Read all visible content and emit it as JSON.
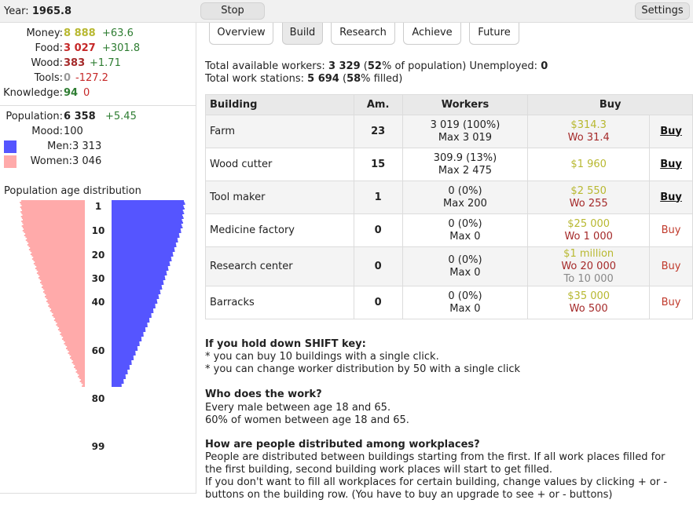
{
  "topbar": {
    "year_label": "Year:",
    "year_value": "1965.8",
    "stop_label": "Stop",
    "settings_label": "Settings"
  },
  "resources": {
    "money": {
      "label": "Money:",
      "value": "8 888",
      "delta": "+63.6"
    },
    "food": {
      "label": "Food:",
      "value": "3 027",
      "delta": "+301.8"
    },
    "wood": {
      "label": "Wood:",
      "value": "383",
      "delta": "+1.71"
    },
    "tools": {
      "label": "Tools:",
      "value": "0",
      "delta": "-127.2"
    },
    "knowledge": {
      "label": "Knowledge:",
      "value": "94",
      "delta": "0"
    }
  },
  "population": {
    "label": "Population:",
    "value": "6 358",
    "delta": "+5.45",
    "mood_label": "Mood:",
    "mood_value": "100",
    "men_label": "Men:",
    "men_value": "3 313",
    "women_label": "Women:",
    "women_value": "3 046",
    "men_color": "#5555ff",
    "women_color": "#ffaaaa"
  },
  "age_distribution": {
    "title": "Population age distribution",
    "age_labels": [
      "1",
      "10",
      "20",
      "30",
      "40",
      "60",
      "80",
      "99"
    ]
  },
  "tabs": [
    {
      "label": "Overview"
    },
    {
      "label": "Build"
    },
    {
      "label": "Research"
    },
    {
      "label": "Achieve"
    },
    {
      "label": "Future"
    }
  ],
  "workers_summary": {
    "available_prefix": "Total available workers:",
    "available_value": "3 329",
    "available_pct": "52",
    "available_suffix": "% of population) Unemployed:",
    "unemployed_value": "0",
    "stations_prefix": "Total work stations:",
    "stations_value": "5 694",
    "stations_pct": "58",
    "stations_suffix": "% filled)"
  },
  "buildings_table": {
    "headers": {
      "building": "Building",
      "amount": "Am.",
      "workers": "Workers",
      "buy": "Buy"
    },
    "rows": [
      {
        "name": "Farm",
        "amount": "23",
        "workers": "3 019 (100%)",
        "max": "Max 3 019",
        "cost_money": "$314.3",
        "cost_wood": "Wo 31.4",
        "cost_tools": "",
        "buy": "Buy",
        "can_buy": true
      },
      {
        "name": "Wood cutter",
        "amount": "15",
        "workers": "309.9 (13%)",
        "max": "Max 2 475",
        "cost_money": "$1 960",
        "cost_wood": "",
        "cost_tools": "",
        "buy": "Buy",
        "can_buy": true
      },
      {
        "name": "Tool maker",
        "amount": "1",
        "workers": "0 (0%)",
        "max": "Max 200",
        "cost_money": "$2 550",
        "cost_wood": "Wo 255",
        "cost_tools": "",
        "buy": "Buy",
        "can_buy": true
      },
      {
        "name": "Medicine factory",
        "amount": "0",
        "workers": "0 (0%)",
        "max": "Max 0",
        "cost_money": "$25 000",
        "cost_wood": "Wo 1 000",
        "cost_tools": "",
        "buy": "Buy",
        "can_buy": false
      },
      {
        "name": "Research center",
        "amount": "0",
        "workers": "0 (0%)",
        "max": "Max 0",
        "cost_money": "$1 million",
        "cost_wood": "Wo 20 000",
        "cost_tools": "To 10 000",
        "buy": "Buy",
        "can_buy": false
      },
      {
        "name": "Barracks",
        "amount": "0",
        "workers": "0 (0%)",
        "max": "Max 0",
        "cost_money": "$35 000",
        "cost_wood": "Wo 500",
        "cost_tools": "",
        "buy": "Buy",
        "can_buy": false
      }
    ]
  },
  "help": {
    "shift_title": "If you hold down SHIFT key:",
    "shift_line1": "* you can buy 10 buildings with a single click.",
    "shift_line2": "* you can change worker distribution by 50 with a single click",
    "work_title": "Who does the work?",
    "work_line1": "Every male between age 18 and 65.",
    "work_line2": "60% of women between age 18 and 65.",
    "dist_title": "How are people distributed among workplaces?",
    "dist_line1": "People are distributed between buildings starting from the first. If all work places filled for",
    "dist_line2": "the first building, second building work places will start to get filled.",
    "dist_line3": "If you don't want to fill all workplaces for certain building, change values by clicking + or -",
    "dist_line4": "buttons on the building row. (You have to buy an upgrade to see + or - buttons)"
  }
}
